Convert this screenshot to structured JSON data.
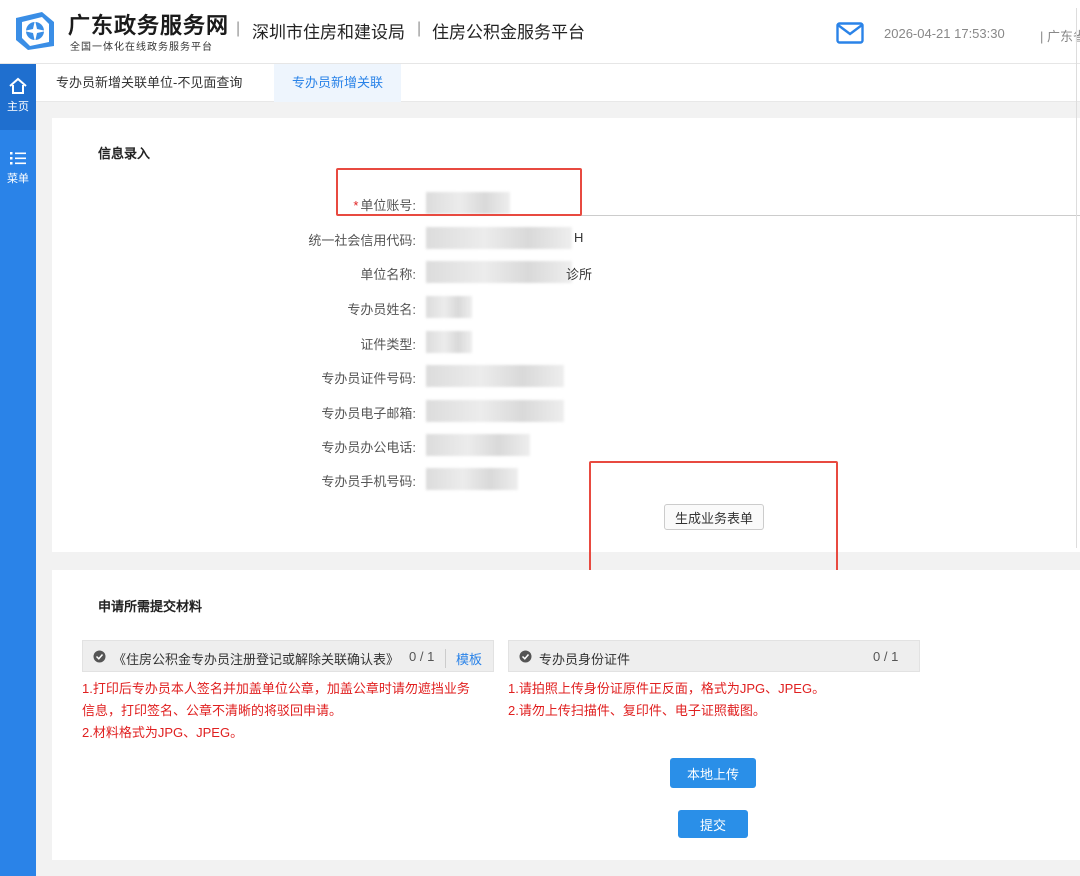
{
  "header": {
    "site_title": "广东政务服务网",
    "site_subtitle": "全国一体化在线政务服务平台",
    "separator": "|",
    "bureau": "深圳市住房和建设局",
    "platform": "住房公积金服务平台",
    "datetime": "2026-04-21 17:53:30",
    "region": "| 广东省"
  },
  "sidebar": {
    "home_label": "主页",
    "menu_label": "菜单",
    "accent": "#2a83e8"
  },
  "tabs": [
    {
      "label": "专办员新增关联单位-不见面查询",
      "active": false
    },
    {
      "label": "专办员新增关联",
      "active": true
    }
  ],
  "info": {
    "title": "信息录入",
    "fields": [
      {
        "label": "单位账号:",
        "required": true,
        "tail": ""
      },
      {
        "label": "统一社会信用代码:",
        "required": false,
        "tail": "H"
      },
      {
        "label": "单位名称:",
        "required": false,
        "tail": "诊所"
      },
      {
        "label": "专办员姓名:",
        "required": false,
        "tail": ""
      },
      {
        "label": "证件类型:",
        "required": false,
        "tail": ""
      },
      {
        "label": "专办员证件号码:",
        "required": false,
        "tail": ""
      },
      {
        "label": "专办员电子邮箱:",
        "required": false,
        "tail": ""
      },
      {
        "label": "专办员办公电话:",
        "required": false,
        "tail": ""
      },
      {
        "label": "专办员手机号码:",
        "required": false,
        "tail": ""
      }
    ],
    "required_mark": "*",
    "generate_button": "生成业务表单"
  },
  "materials": {
    "title": "申请所需提交材料",
    "items": [
      {
        "name": "《住房公积金专办员注册登记或解除关联确认表》",
        "count": "0 / 1",
        "template_link": "模板",
        "notes": [
          "1.打印后专办员本人签名并加盖单位公章，加盖公章时请勿遮挡业务",
          "信息，打印签名、公章不清晰的将驳回申请。",
          "2.材料格式为JPG、JPEG。"
        ]
      },
      {
        "name": "专办员身份证件",
        "count": "0 / 1",
        "notes": [
          "1.请拍照上传身份证原件正反面，格式为JPG、JPEG。",
          "2.请勿上传扫描件、复印件、电子证照截图。"
        ]
      }
    ],
    "upload_button": "本地上传",
    "submit_button": "提交"
  }
}
